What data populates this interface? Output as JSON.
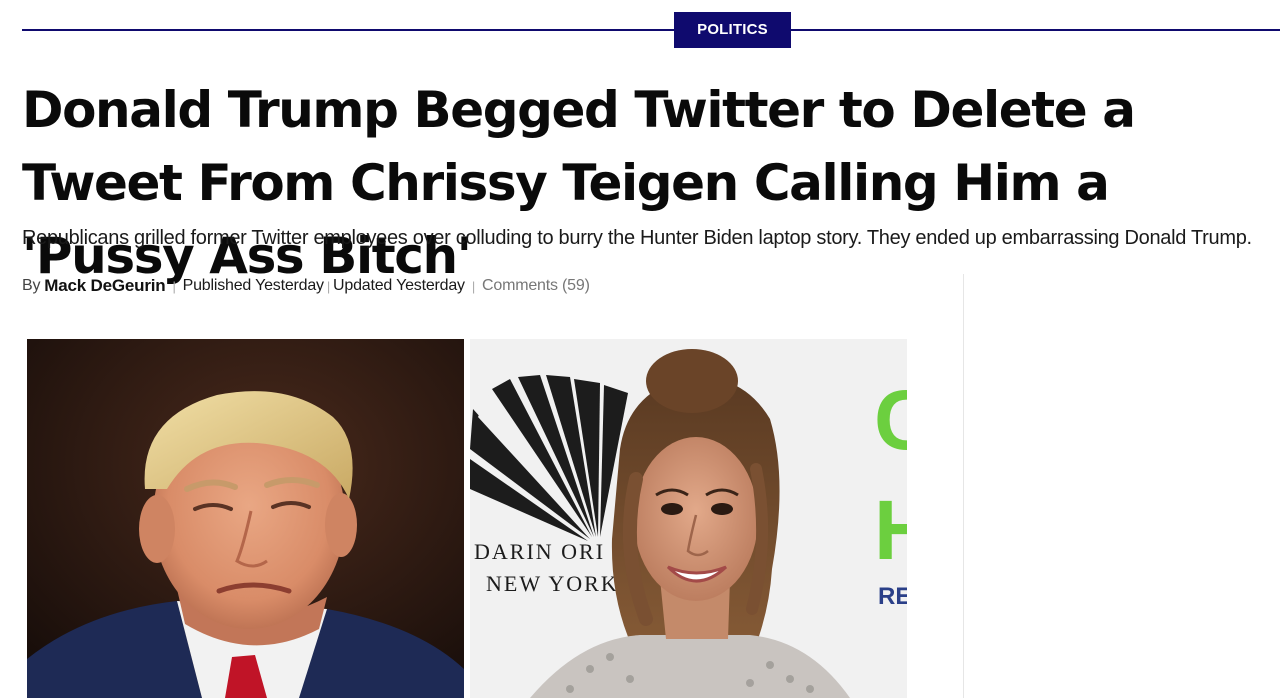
{
  "category": {
    "label": "POLITICS"
  },
  "article": {
    "headline": "Donald Trump Begged Twitter to Delete a Tweet From Chrissy Teigen Calling Him a 'Pussy Ass Bitch'",
    "subheadline": "Republicans grilled former Twitter employees over colluding to burry the Hunter Biden laptop story. They ended up embarrassing Donald Trump.",
    "byline": {
      "prefix": "By",
      "author": "Mack DeGeurin",
      "published": "Published Yesterday",
      "updated": "Updated Yesterday",
      "comments": "Comments (59)",
      "separator": "|"
    }
  },
  "photo_right": {
    "backdrop_line_1": "DARIN ORI",
    "backdrop_line_2": "NEW YORK",
    "green_letters": [
      "C",
      "H"
    ],
    "green_text": "RE"
  },
  "colors": {
    "brand_navy": "#0f0a6e",
    "text_dark": "#0a0a0a",
    "muted": "#777777",
    "backdrop_green": "#6ccf3f"
  },
  "icons": {
    "photo_left": "donald-trump-photo",
    "photo_right": "chrissy-teigen-photo"
  }
}
